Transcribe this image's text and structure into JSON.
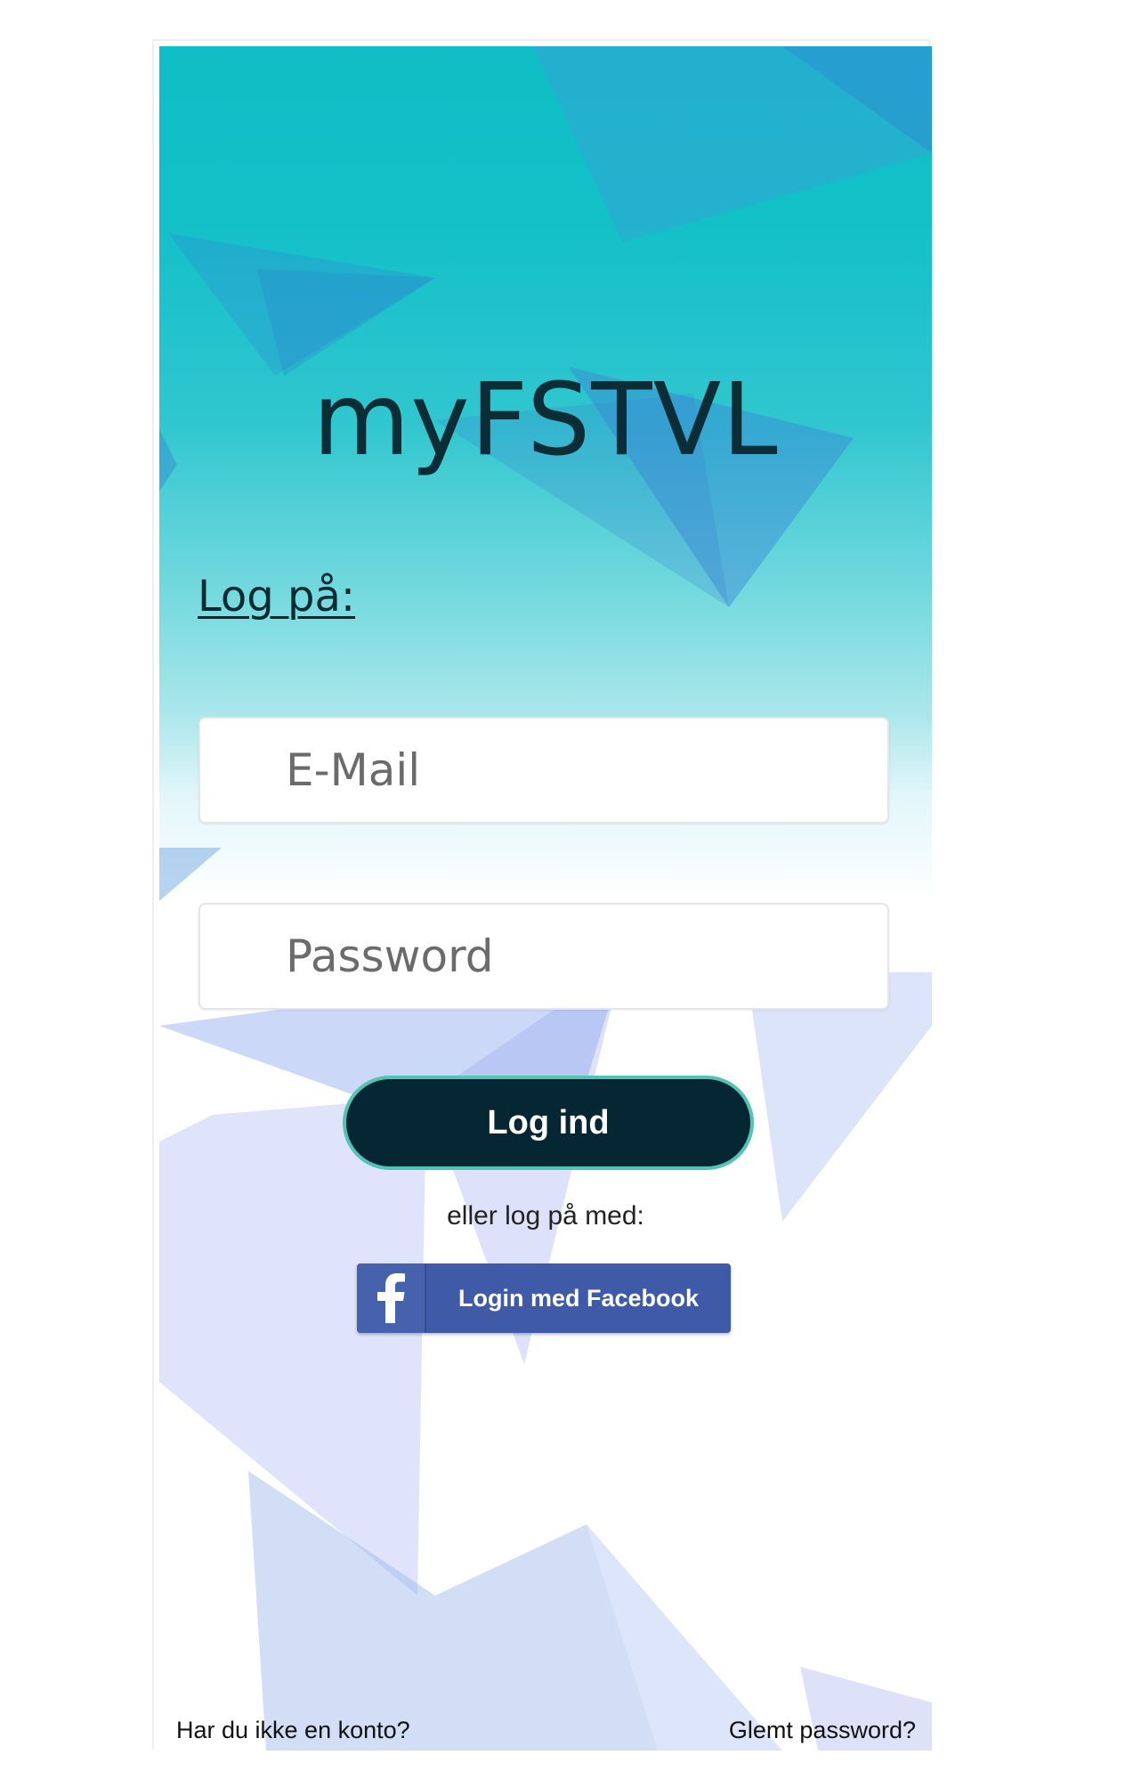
{
  "app": {
    "title": "myFSTVL"
  },
  "login": {
    "heading": "Log på:",
    "email_placeholder": "E-Mail",
    "password_placeholder": "Password",
    "submit_label": "Log ind",
    "alt_text": "eller log på med:",
    "facebook_label": "Login med Facebook"
  },
  "footer": {
    "no_account": "Har du ikke en konto?",
    "forgot_password": "Glemt password?"
  },
  "colors": {
    "accent_dark": "#052633",
    "accent_teal": "#52c4b4",
    "facebook_blue": "#3f5ba8",
    "title_text": "#0b2d36"
  },
  "icons": {
    "facebook": "facebook-icon"
  }
}
